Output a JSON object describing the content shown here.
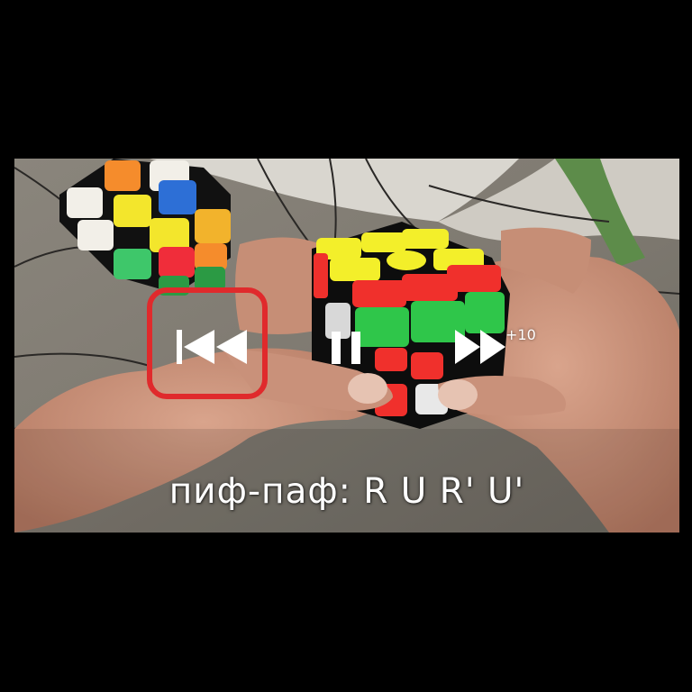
{
  "video": {
    "caption": "пиф-паф: R U R' U'",
    "controls": {
      "rewind_icon": "rewind-icon",
      "pause_icon": "pause-icon",
      "forward_icon": "fast-forward-icon",
      "forward_skip_label": "+10"
    },
    "highlight_color": "#e02a2c"
  }
}
